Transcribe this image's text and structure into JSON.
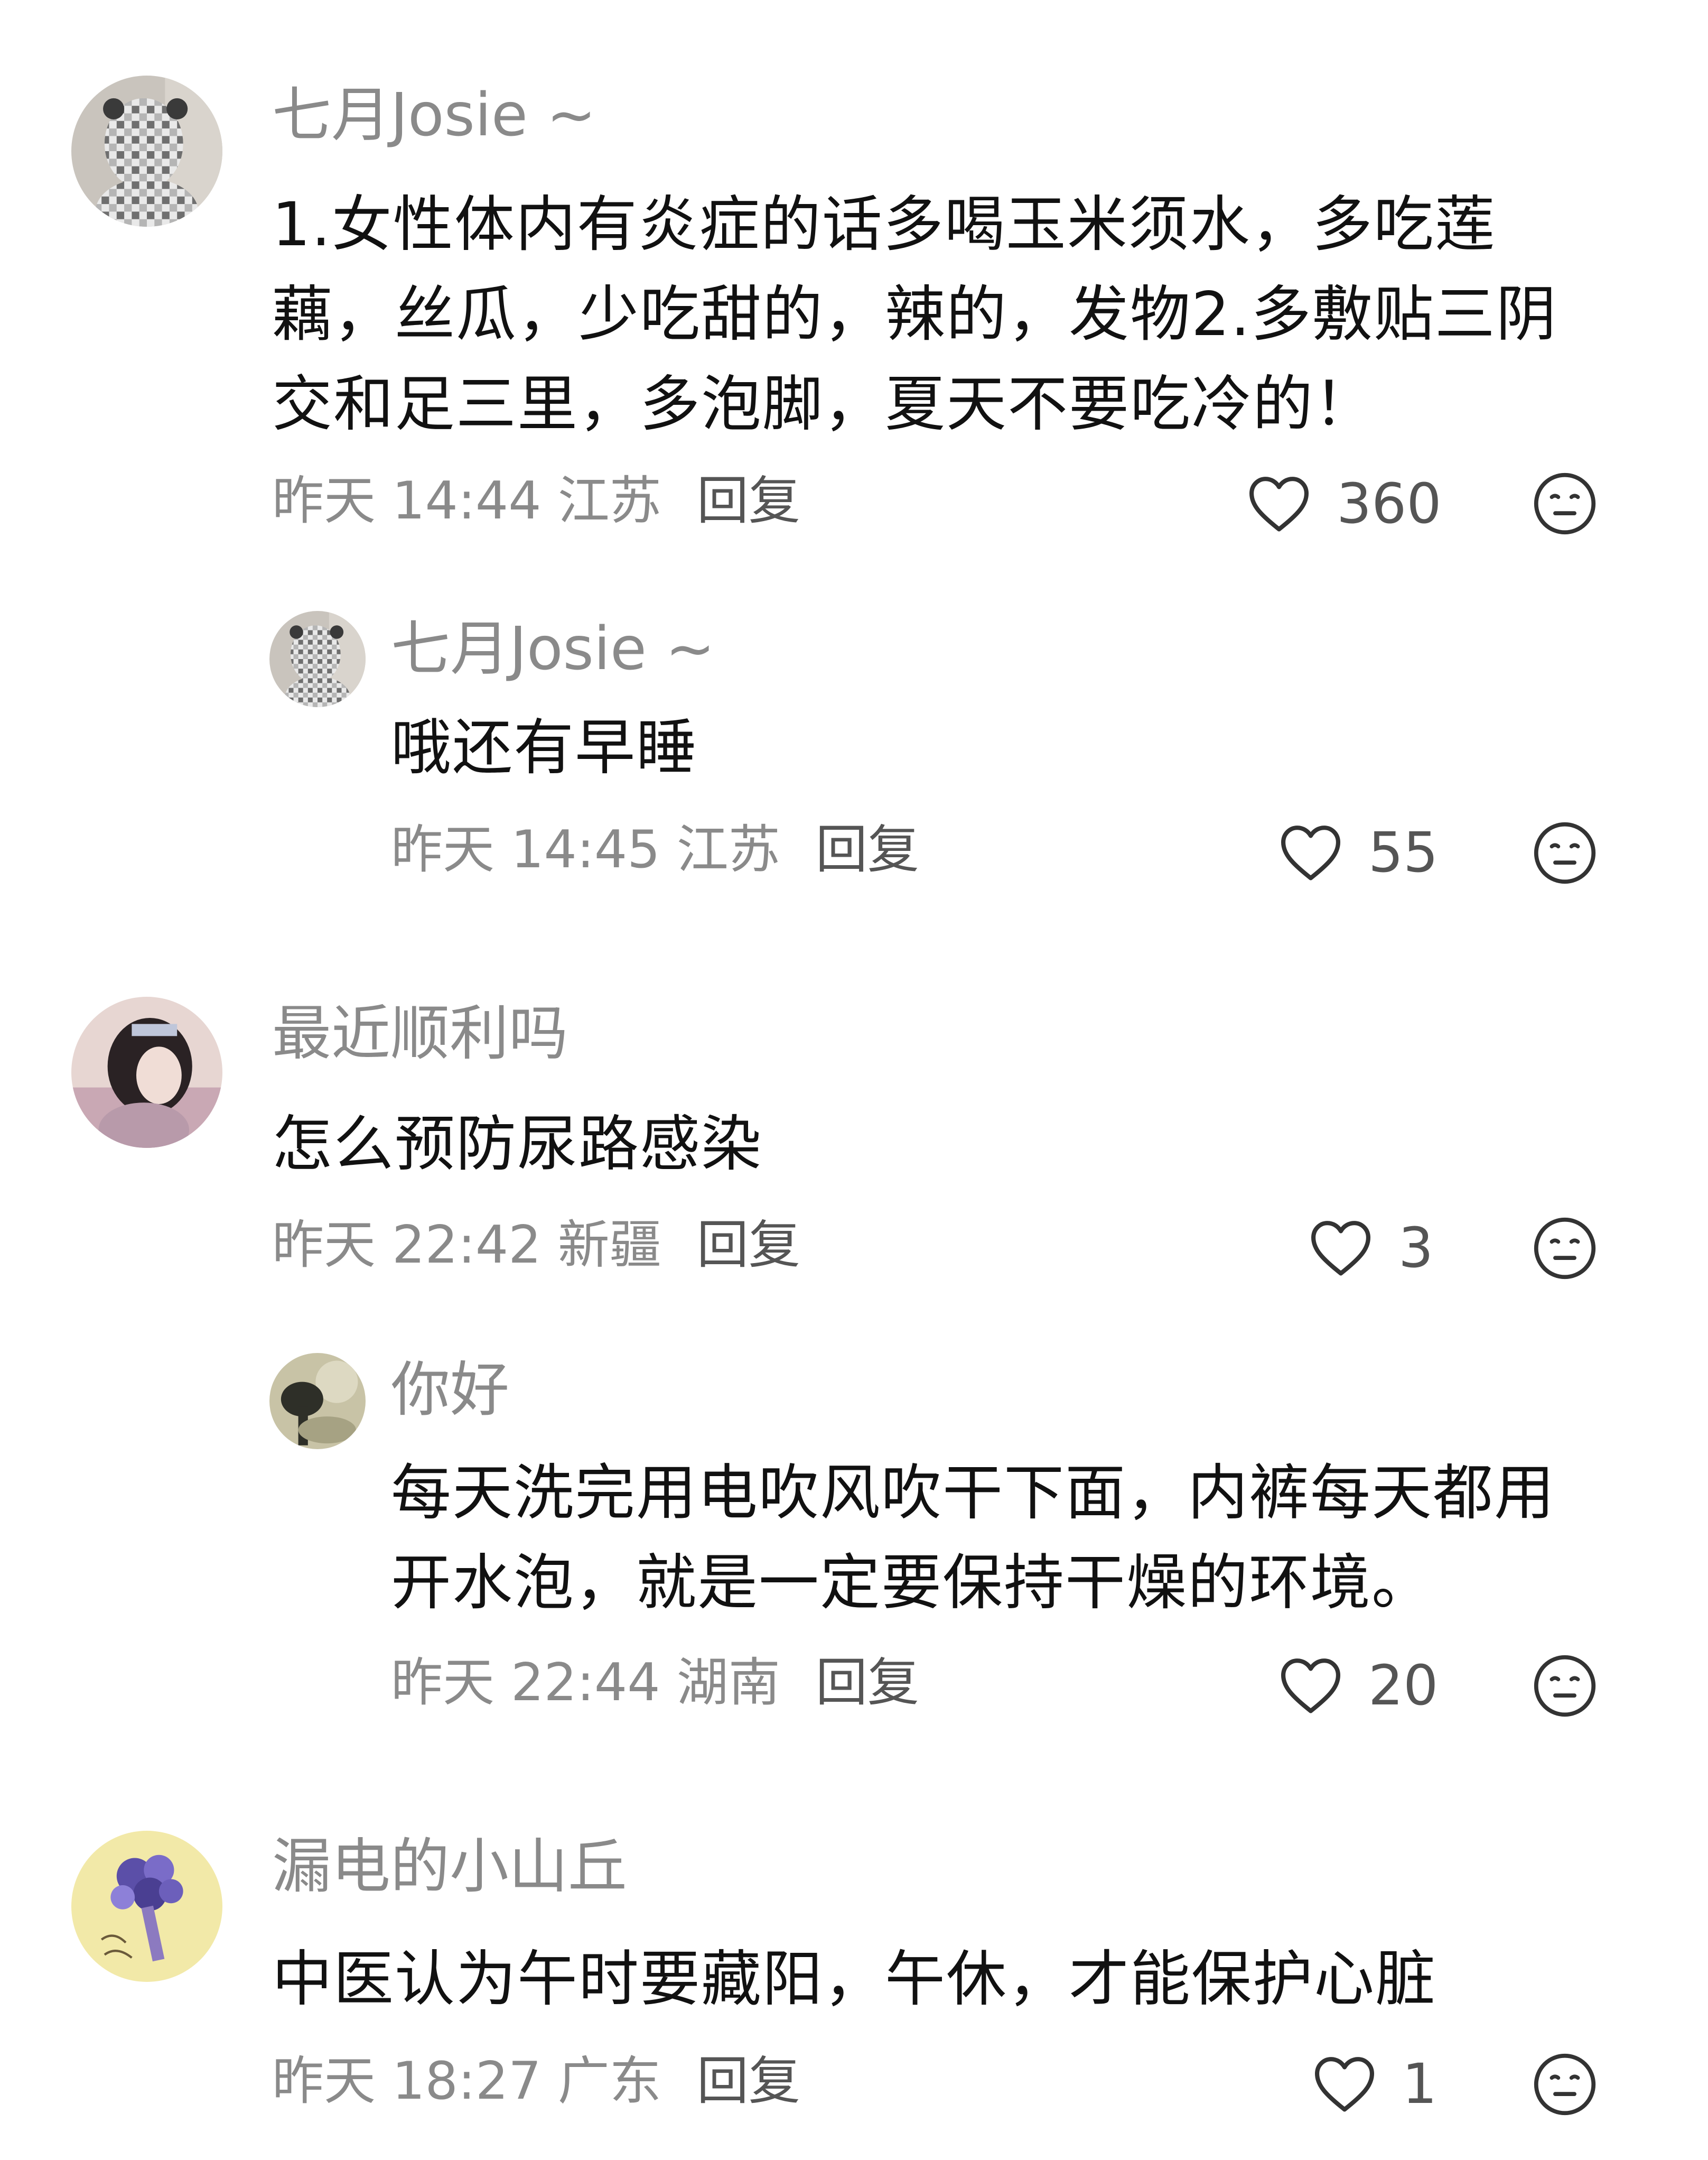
{
  "comments": [
    {
      "username": "七月Josie ~",
      "text": "1.女性体内有炎症的话多喝玉米须水，多吃莲藕，丝瓜，少吃甜的，辣的，发物2.多敷贴三阴交和足三里，多泡脚，夏天不要吃冷的！",
      "time": "昨天 14:44",
      "location": "江苏",
      "reply_label": "回复",
      "likes": "360"
    },
    {
      "username": "七月Josie ~",
      "text": "哦还有早睡",
      "time": "昨天 14:45",
      "location": "江苏",
      "reply_label": "回复",
      "likes": "55"
    },
    {
      "username": "最近顺利吗",
      "text": "怎么预防尿路感染",
      "time": "昨天 22:42",
      "location": "新疆",
      "reply_label": "回复",
      "likes": "3"
    },
    {
      "username": "你好",
      "text": "每天洗完用电吹风吹干下面，内裤每天都用开水泡，就是一定要保持干燥的环境。",
      "time": "昨天 22:44",
      "location": "湖南",
      "reply_label": "回复",
      "likes": "20"
    },
    {
      "username": "漏电的小山丘",
      "text": "中医认为午时要藏阳，午休，才能保护心脏",
      "time": "昨天 18:27",
      "location": "广东",
      "reply_label": "回复",
      "likes": "1"
    }
  ],
  "icons": {
    "like": "heart-outline-icon",
    "emoji": "neutral-face-icon"
  },
  "colors": {
    "username": "#8a8a8a",
    "content": "#111111",
    "meta": "#8a8a8a"
  }
}
